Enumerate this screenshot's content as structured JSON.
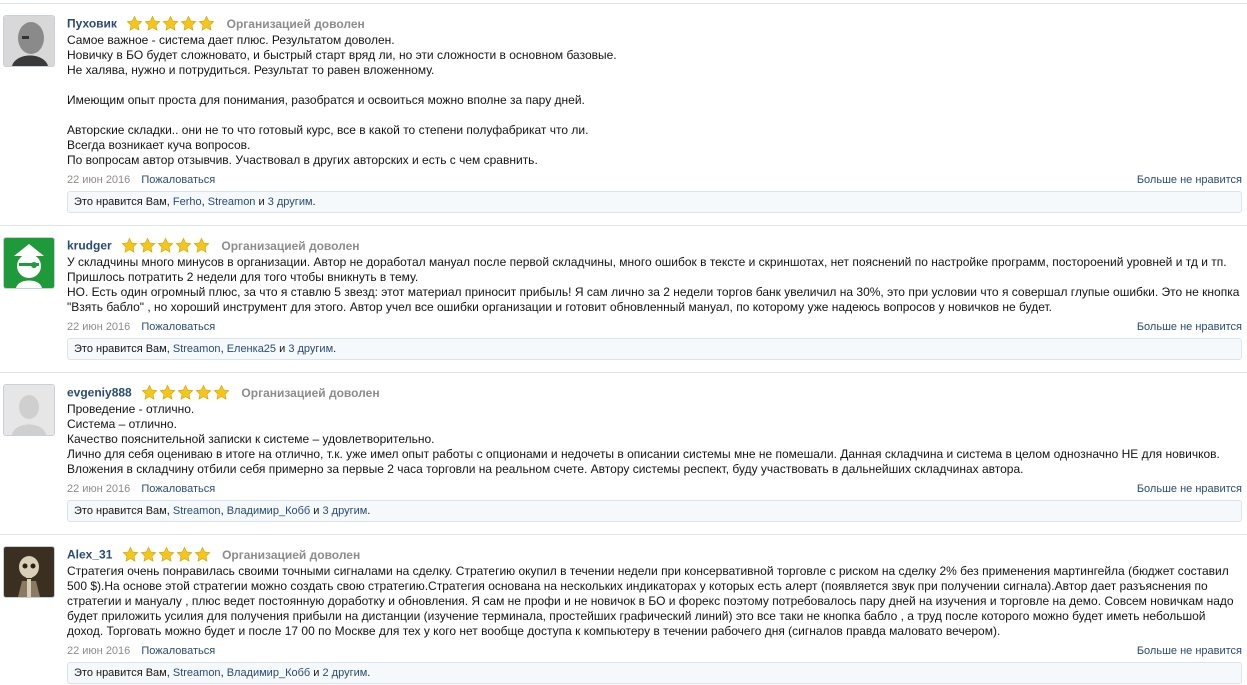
{
  "reviews": [
    {
      "username": "Пуховик",
      "rating": 5,
      "verdict": "Организацией доволен",
      "text": "Самое важное - система дает плюс. Результатом доволен.\nНовичку в БО будет сложновато, и быстрый старт вряд ли, но эти сложности в основном базовые.\nНе халява, нужно и потрудиться. Результат то равен вложенному.\n\nИмеющим опыт проста для понимания, разобратся и освоиться можно вполне за пару дней.\n\nАвторские складки.. они не то что готовый курс, все в какой то степени полуфабрикат что ли.\nВсегда возникает куча вопросов.\nПо вопросам автор отзывчив. Участвовал в других авторских и есть с чем сравнить.",
      "date": "22 июн 2016",
      "report_label": "Пожаловаться",
      "dislike_label": "Больше не нравится",
      "likes": {
        "prefix": "Это нравится Вам,",
        "user1": "Ferho",
        "sep": ",",
        "user2": "Streamon",
        "and": "и",
        "others": "3 другим",
        "end": "."
      }
    },
    {
      "username": "krudger",
      "rating": 5,
      "verdict": "Организацией доволен",
      "text": "У складчины много минусов в организации. Автор не доработал мануал после первой складчины, много ошибок в тексте и скриншотах, нет пояснений по настройке программ, постороений уровней и тд и тп.\nПришлось потратить 2 недели для того чтобы вникнуть в тему.\nНО. Есть один огромный плюс, за что я ставлю 5 звезд: этот материал приносит прибыль! Я сам лично за 2 недели торгов банк увеличил на 30%, это при условии что я совершал глупые ошибки. Это не кнопка \"Взять бабло\" , но хороший инструмент для этого. Автор учел все ошибки организации и готовит обновленный мануал, по которому уже надеюсь вопросов у новичков не будет.",
      "date": "22 июн 2016",
      "report_label": "Пожаловаться",
      "dislike_label": "Больше не нравится",
      "likes": {
        "prefix": "Это нравится Вам,",
        "user1": "Streamon",
        "sep": ",",
        "user2": "Еленка25",
        "and": "и",
        "others": "3 другим",
        "end": "."
      }
    },
    {
      "username": "evgeniy888",
      "rating": 5,
      "verdict": "Организацией доволен",
      "text": "Проведение - отлично.\nСистема – отлично.\nКачество пояснительной записки к системе – удовлетворительно.\nЛично для себя оцениваю в итоге на отлично, т.к. уже имел опыт работы с опционами и недочеты в описании системы мне не помешали. Данная складчина и система в целом однозначно НЕ для новичков.\nВложения в складчину отбили себя примерно за первые 2 часа торговли на реальном счете. Автору системы респект, буду участвовать в дальнейших складчинах автора.",
      "date": "22 июн 2016",
      "report_label": "Пожаловаться",
      "dislike_label": "Больше не нравится",
      "likes": {
        "prefix": "Это нравится Вам,",
        "user1": "Streamon",
        "sep": ",",
        "user2": "Владимир_Кобб",
        "and": "и",
        "others": "3 другим",
        "end": "."
      }
    },
    {
      "username": "Alex_31",
      "rating": 5,
      "verdict": "Организацией доволен",
      "text": "Стратегия очень понравилась своими точными сигналами на сделку. Стратегию окупил в течении недели при консервативной торговле с риском на сделку 2% без применения мартингейла (бюджет составил 500 $).На основе этой стратегии можно создать свою стратегию.Стратегия основана на нескольких индикаторах у которых есть алерт (появляется звук при получении сигнала).Автор дает разъяснения по стратегии и мануалу , плюс ведет постоянную доработку и обновления. Я сам не профи и не новичок в БО и форекс поэтому потребовалось пару дней на изучения и торговле на демо. Совсем новичкам надо будет приложить усилия для получения прибыли на дистанции (изучение терминала, простейших графический линий) это все таки не кнопка бабло , а труд после которого можно будет иметь небольшой доход. Торговать можно будет и после 17 00 по Москве для тех у кого нет вообще доступа к компьютеру в течении рабочего дня (сигналов правда маловато вечером).",
      "date": "22 июн 2016",
      "report_label": "Пожаловаться",
      "dislike_label": "Больше не нравится",
      "likes": {
        "prefix": "Это нравится Вам,",
        "user1": "Streamon",
        "sep": ",",
        "user2": "Владимир_Кобб",
        "and": "и",
        "others": "2 другим",
        "end": "."
      }
    }
  ],
  "colors": {
    "link": "#2b4a72",
    "muted": "#8c8c8c",
    "star": "#f5c518",
    "likes_bg": "#f5f9fc"
  }
}
